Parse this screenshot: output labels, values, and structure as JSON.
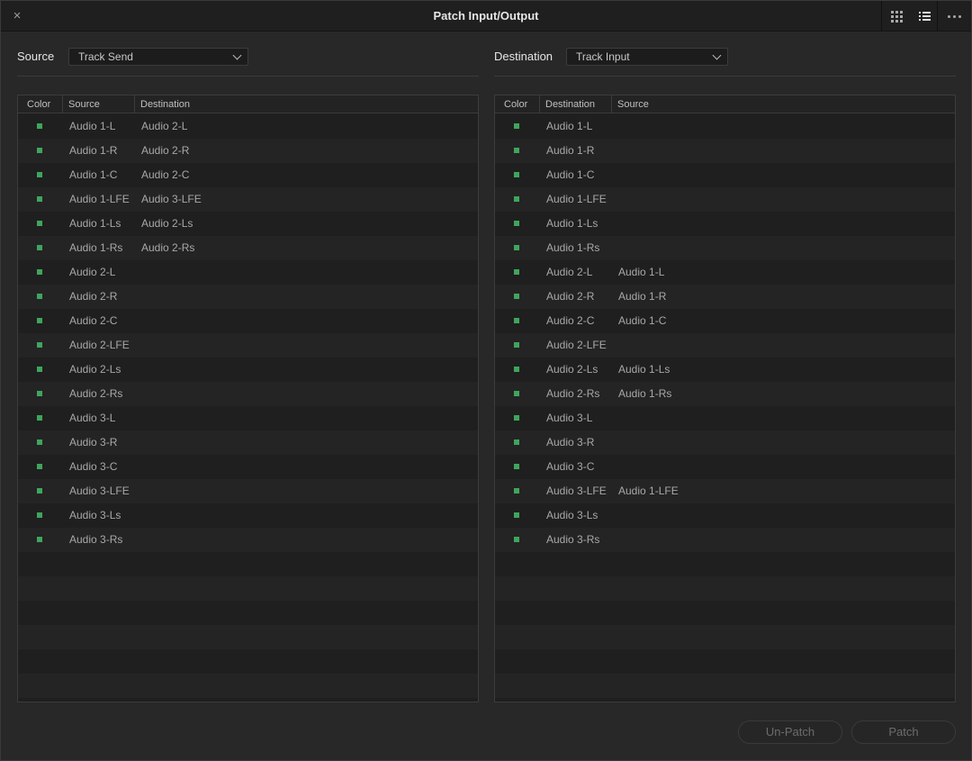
{
  "window": {
    "title": "Patch Input/Output",
    "close_icon": "×"
  },
  "left": {
    "label": "Source",
    "dropdown_value": "Track Send",
    "columns": [
      "Color",
      "Source",
      "Destination"
    ],
    "rows": [
      {
        "source": "Audio 1-L",
        "dest": "Audio 2-L"
      },
      {
        "source": "Audio 1-R",
        "dest": "Audio 2-R"
      },
      {
        "source": "Audio 1-C",
        "dest": "Audio 2-C"
      },
      {
        "source": "Audio 1-LFE",
        "dest": "Audio 3-LFE"
      },
      {
        "source": "Audio 1-Ls",
        "dest": "Audio 2-Ls"
      },
      {
        "source": "Audio 1-Rs",
        "dest": "Audio 2-Rs"
      },
      {
        "source": "Audio 2-L",
        "dest": ""
      },
      {
        "source": "Audio 2-R",
        "dest": ""
      },
      {
        "source": "Audio 2-C",
        "dest": ""
      },
      {
        "source": "Audio 2-LFE",
        "dest": ""
      },
      {
        "source": "Audio 2-Ls",
        "dest": ""
      },
      {
        "source": "Audio 2-Rs",
        "dest": ""
      },
      {
        "source": "Audio 3-L",
        "dest": ""
      },
      {
        "source": "Audio 3-R",
        "dest": ""
      },
      {
        "source": "Audio 3-C",
        "dest": ""
      },
      {
        "source": "Audio 3-LFE",
        "dest": ""
      },
      {
        "source": "Audio 3-Ls",
        "dest": ""
      },
      {
        "source": "Audio 3-Rs",
        "dest": ""
      }
    ]
  },
  "right": {
    "label": "Destination",
    "dropdown_value": "Track Input",
    "columns": [
      "Color",
      "Destination",
      "Source"
    ],
    "rows": [
      {
        "dest": "Audio 1-L",
        "source": ""
      },
      {
        "dest": "Audio 1-R",
        "source": ""
      },
      {
        "dest": "Audio 1-C",
        "source": ""
      },
      {
        "dest": "Audio 1-LFE",
        "source": ""
      },
      {
        "dest": "Audio 1-Ls",
        "source": ""
      },
      {
        "dest": "Audio 1-Rs",
        "source": ""
      },
      {
        "dest": "Audio 2-L",
        "source": "Audio 1-L"
      },
      {
        "dest": "Audio 2-R",
        "source": "Audio 1-R"
      },
      {
        "dest": "Audio 2-C",
        "source": "Audio 1-C"
      },
      {
        "dest": "Audio 2-LFE",
        "source": ""
      },
      {
        "dest": "Audio 2-Ls",
        "source": "Audio 1-Ls"
      },
      {
        "dest": "Audio 2-Rs",
        "source": "Audio 1-Rs"
      },
      {
        "dest": "Audio 3-L",
        "source": ""
      },
      {
        "dest": "Audio 3-R",
        "source": ""
      },
      {
        "dest": "Audio 3-C",
        "source": ""
      },
      {
        "dest": "Audio 3-LFE",
        "source": "Audio 1-LFE"
      },
      {
        "dest": "Audio 3-Ls",
        "source": ""
      },
      {
        "dest": "Audio 3-Rs",
        "source": ""
      }
    ]
  },
  "buttons": {
    "unpatch": "Un-Patch",
    "patch": "Patch"
  },
  "colors": {
    "track_swatch": "#3fa55c"
  },
  "icons": {
    "grid_view": "grid-icon",
    "list_view": "list-icon",
    "more": "more-icon"
  }
}
